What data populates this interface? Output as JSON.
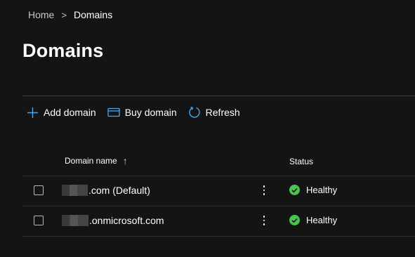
{
  "breadcrumb": {
    "home": "Home",
    "separator": ">",
    "current": "Domains"
  },
  "page_title": "Domains",
  "toolbar": {
    "add_domain": {
      "label": "Add domain",
      "icon": "plus-icon"
    },
    "buy_domain": {
      "label": "Buy domain",
      "icon": "card-icon"
    },
    "refresh": {
      "label": "Refresh",
      "icon": "refresh-icon"
    }
  },
  "table": {
    "columns": {
      "domain_name": "Domain name",
      "sort_indicator": "↑",
      "status": "Status"
    },
    "rows": [
      {
        "domain": ".com (Default)",
        "status": "Healthy"
      },
      {
        "domain": ".onmicrosoft.com",
        "status": "Healthy"
      }
    ]
  },
  "colors": {
    "background": "#141414",
    "accent": "#4ea6e8",
    "healthy": "#4cc253"
  }
}
